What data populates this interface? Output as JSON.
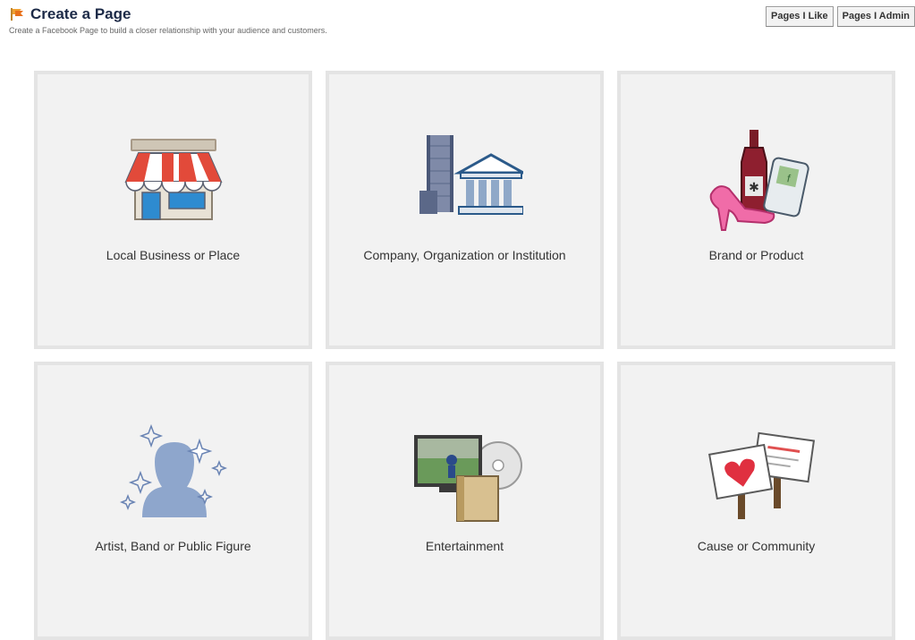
{
  "header": {
    "title": "Create a Page",
    "subtitle": "Create a Facebook Page to build a closer relationship with your audience and customers."
  },
  "toolbar": {
    "pages_like_label": "Pages I Like",
    "pages_admin_label": "Pages I Admin"
  },
  "categories": [
    {
      "label": "Local Business or Place",
      "icon": "storefront-icon"
    },
    {
      "label": "Company, Organization or Institution",
      "icon": "buildings-icon"
    },
    {
      "label": "Brand or Product",
      "icon": "products-icon"
    },
    {
      "label": "Artist, Band or Public Figure",
      "icon": "silhouette-icon"
    },
    {
      "label": "Entertainment",
      "icon": "media-icon"
    },
    {
      "label": "Cause or Community",
      "icon": "signs-icon"
    }
  ],
  "colors": {
    "title": "#1c2a47",
    "tile_bg": "#f2f2f2",
    "tile_border": "#e4e4e4"
  }
}
